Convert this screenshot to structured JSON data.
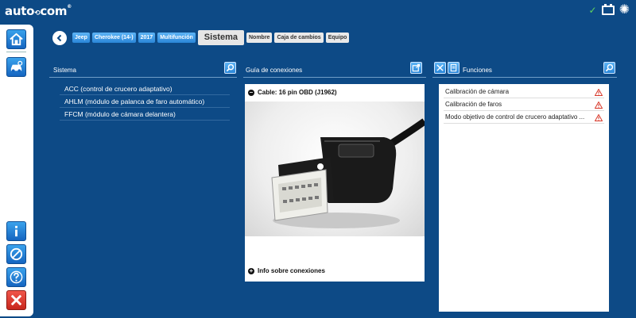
{
  "app": {
    "logo": "auto",
    "logo_connector": "com",
    "logo_reg": "®"
  },
  "breadcrumb": {
    "items": [
      "Jeep",
      "Cherokee (14-)",
      "2017",
      "Multifunción"
    ],
    "active": "Sistema",
    "filters": [
      "Nombre",
      "Caja de cambios",
      "Equipo"
    ]
  },
  "system_section": {
    "title": "Sistema",
    "items": [
      "ACC (control de crucero adaptativo)",
      "AHLM (módulo de palanca de faro automático)",
      "FFCM (módulo de cámara delantera)"
    ]
  },
  "connection_section": {
    "title": "Guía de conexiones",
    "cable_label": "Cable: 16 pin OBD (J1962)",
    "info_label": "Info sobre conexiones"
  },
  "functions_section": {
    "title": "Funciones",
    "items": [
      "Calibración de cámara",
      "Calibración de faros",
      "Modo objetivo de control de crucero adaptativo ..."
    ]
  },
  "colors": {
    "background": "#0d4a86",
    "accent": "#2a86d8",
    "warning": "#d83a2c",
    "status_ok": "#5fd35f"
  },
  "icons": [
    "home-icon",
    "vehicle-icon",
    "info-icon",
    "no-smoking-icon",
    "help-icon",
    "close-icon",
    "search-icon",
    "external-link-icon",
    "tools-icon",
    "document-icon",
    "warning-icon",
    "battery-icon",
    "gear-icon",
    "check-icon"
  ]
}
